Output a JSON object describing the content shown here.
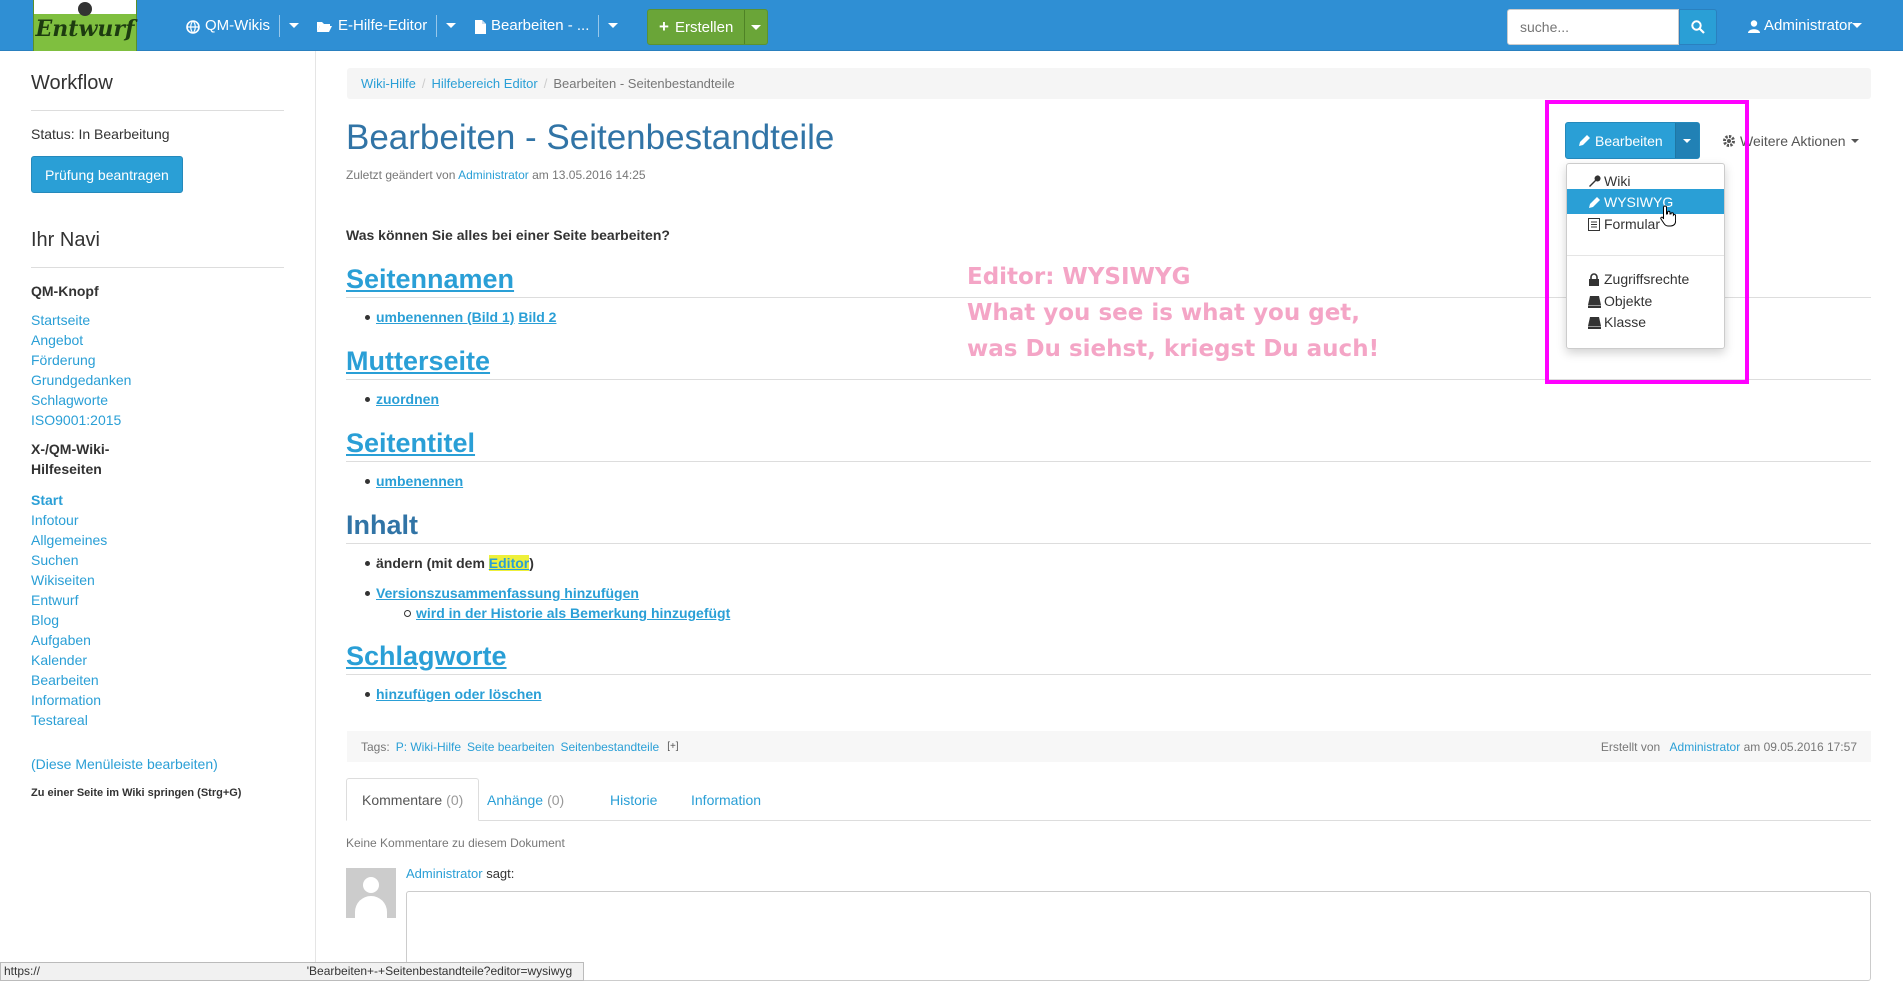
{
  "topbar": {
    "logo_text": "Entwurf",
    "nav": [
      {
        "label": "QM-Wikis",
        "icon": "globe-icon"
      },
      {
        "label": "E-Hilfe-Editor",
        "icon": "folder-open-icon"
      },
      {
        "label": "Bearbeiten - ...",
        "icon": "file-icon"
      }
    ],
    "create_label": "Erstellen",
    "search_placeholder": "suche...",
    "user_label": "Administrator"
  },
  "sidebar": {
    "workflow_title": "Workflow",
    "status_text": "Status: In Bearbeitung",
    "review_button": "Prüfung beantragen",
    "navi_title": "Ihr Navi",
    "group1_title": "QM-Knopf",
    "group1_links": [
      "Startseite",
      "Angebot",
      "Förderung",
      "Grundgedanken",
      "Schlagworte",
      "ISO9001:2015"
    ],
    "group2_title_line1": "X-/QM-Wiki-",
    "group2_title_line2": "Hilfeseiten",
    "group2_active": "Start",
    "group2_links": [
      "Infotour",
      "Allgemeines",
      "Suchen",
      "Wikiseiten",
      "Entwurf",
      "Blog",
      "Aufgaben",
      "Kalender",
      "Bearbeiten",
      "Information",
      "Testareal"
    ],
    "edit_menu_link": "(Diese Menüleiste bearbeiten)",
    "jump_text": "Zu einer Seite im Wiki springen (Strg+G)"
  },
  "breadcrumb": {
    "items": [
      "Wiki-Hilfe",
      "Hilfebereich Editor"
    ],
    "current": "Bearbeiten - Seitenbestandteile",
    "divider": "/"
  },
  "page": {
    "title": "Bearbeiten - Seitenbestandteile",
    "meta_prefix": "Zuletzt geändert von",
    "meta_user": "Administrator",
    "meta_suffix": "am 13.05.2016 14:25",
    "question": "Was können Sie alles bei einer Seite bearbeiten?",
    "sections": {
      "s1_title": "Seitennamen",
      "s1_link_a": "umbenennen (Bild 1)",
      "s1_link_b": "Bild 2",
      "s2_title": "Mutterseite",
      "s2_link": "zuordnen",
      "s3_title": "Seitentitel",
      "s3_link": "umbenennen",
      "s4_title": "Inhalt",
      "s4_text_a": "ändern (mit dem",
      "s4_highlight": "Editor",
      "s4_text_b": ")",
      "s4_link": "Versionszusammenfassung hinzufügen",
      "s4_sublink": "wird in der Historie als Bemerkung hinzugefügt",
      "s5_title": "Schlagworte",
      "s5_link": "hinzufügen oder löschen"
    },
    "annotation_lines": [
      "Editor: WYSIWYG",
      "What you see is what you get,",
      "was Du siehst, kriegst Du auch!"
    ]
  },
  "tags": {
    "label": "Tags:",
    "items": [
      "P: Wiki-Hilfe",
      "Seite bearbeiten",
      "Seitenbestandteile"
    ],
    "add": "[+]",
    "created_prefix": "Erstellt von",
    "created_user": "Administrator",
    "created_suffix": "am 09.05.2016 17:57"
  },
  "tabs": [
    {
      "label": "Kommentare",
      "count": "(0)"
    },
    {
      "label": "Anhänge",
      "count": "(0)"
    },
    {
      "label": "Historie",
      "count": ""
    },
    {
      "label": "Information",
      "count": ""
    }
  ],
  "comments": {
    "none_text": "Keine Kommentare zu diesem Dokument",
    "user": "Administrator",
    "says": "sagt:"
  },
  "actions": {
    "edit_label": "Bearbeiten",
    "more_label": "Weitere Aktionen",
    "menu": [
      {
        "label": "Wiki",
        "icon": "wrench-icon"
      },
      {
        "label": "WYSIWYG",
        "icon": "pencil-icon"
      },
      {
        "label": "Formular",
        "icon": "list-icon"
      },
      {
        "label": "Zugriffsrechte",
        "icon": "lock-icon"
      },
      {
        "label": "Objekte",
        "icon": "object-icon"
      },
      {
        "label": "Klasse",
        "icon": "class-icon"
      }
    ]
  },
  "statusbar": {
    "url_start": "https://",
    "url_end": "'Bearbeiten+-+Seitenbestandteile?editor=wysiwyg"
  },
  "colors": {
    "primary": "#2a9fd6",
    "topbar": "#2f8fd4",
    "create": "#6aa538",
    "highlight_box": "#ff00ff",
    "annotation": "#f4a5c6"
  }
}
